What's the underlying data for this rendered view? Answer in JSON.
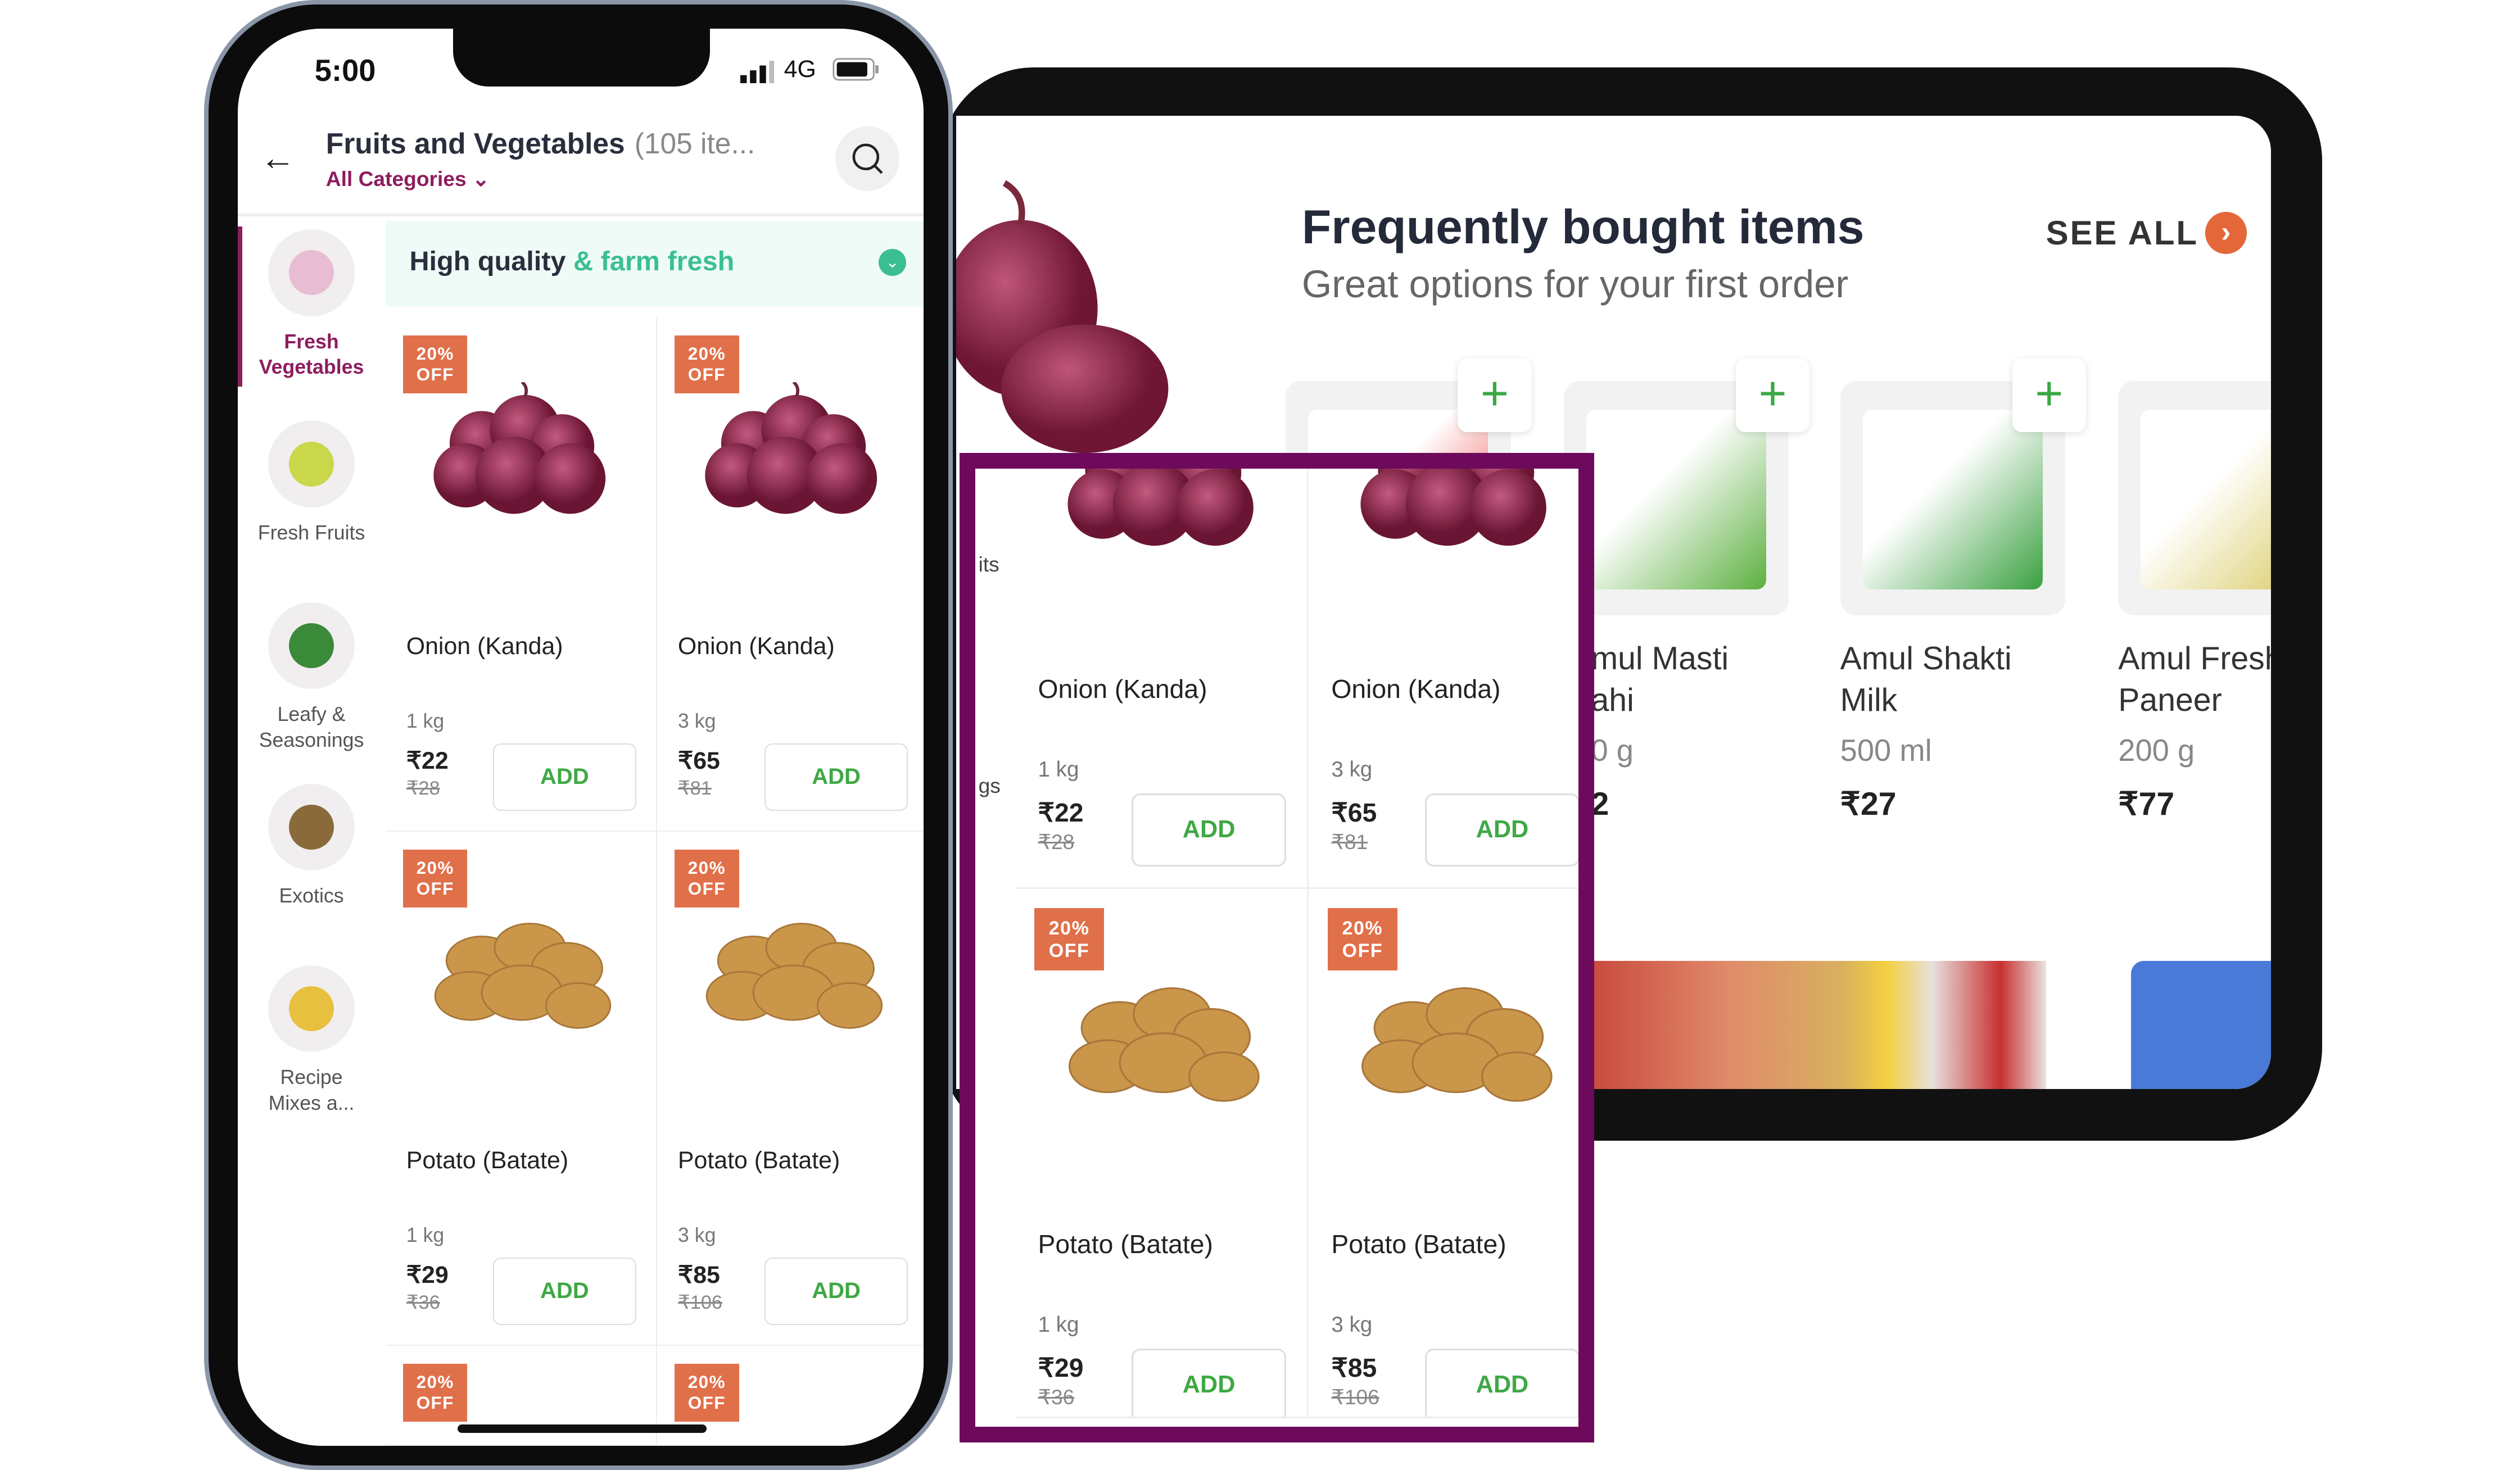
{
  "phone": {
    "status": {
      "time": "5:00",
      "network": "4G"
    },
    "header": {
      "title": "Fruits and Vegetables",
      "count": "(105 ite...",
      "category_dropdown": "All Categories"
    },
    "sidebar": [
      {
        "label_lines": [
          "Fresh",
          "Vegetables"
        ],
        "active": true,
        "image": "onion"
      },
      {
        "label_lines": [
          "Fresh Fruits"
        ],
        "active": false,
        "image": "pear"
      },
      {
        "label_lines": [
          "Leafy &",
          "Seasonings"
        ],
        "active": false,
        "image": "spinach"
      },
      {
        "label_lines": [
          "Exotics"
        ],
        "active": false,
        "image": "kiwi"
      },
      {
        "label_lines": [
          "Recipe",
          "Mixes a..."
        ],
        "active": false,
        "image": "pineapple"
      }
    ],
    "banner": {
      "text_dark": "High quality",
      "text_green": "& farm fresh"
    },
    "products": [
      {
        "discount": "20% OFF",
        "name": "Onion (Kanda)",
        "weight": "1 kg",
        "price": "₹22",
        "old_price": "₹28",
        "add": "ADD",
        "image": "onion"
      },
      {
        "discount": "20% OFF",
        "name": "Onion (Kanda)",
        "weight": "3 kg",
        "price": "₹65",
        "old_price": "₹81",
        "add": "ADD",
        "image": "onion"
      },
      {
        "discount": "20% OFF",
        "name": "Potato (Batate)",
        "weight": "1 kg",
        "price": "₹29",
        "old_price": "₹36",
        "add": "ADD",
        "image": "potato"
      },
      {
        "discount": "20% OFF",
        "name": "Potato (Batate)",
        "weight": "3 kg",
        "price": "₹85",
        "old_price": "₹106",
        "add": "ADD",
        "image": "potato"
      },
      {
        "discount": "20% OFF"
      },
      {
        "discount": "20% OFF"
      }
    ]
  },
  "tablet": {
    "title": "Frequently bought items",
    "subtitle": "Great options for your first order",
    "see_all": "SEE ALL",
    "items": [
      {
        "name_lines": [
          "",
          ""
        ],
        "size": "",
        "price": "",
        "image": "milk-pouch-red"
      },
      {
        "name_lines": [
          "mul Masti",
          "ahi"
        ],
        "size": "0 g",
        "price": "2",
        "image": "masti-dahi"
      },
      {
        "name_lines": [
          "Amul Shakti",
          "Milk"
        ],
        "size": "500 ml",
        "price": "₹27",
        "image": "shakti-milk"
      },
      {
        "name_lines": [
          "Amul Fresh",
          "Paneer"
        ],
        "size": "200 g",
        "price": "₹77",
        "image": "paneer"
      }
    ]
  },
  "overlay": {
    "sidebar_fragments": [
      "its",
      "gs"
    ]
  },
  "colors": {
    "brand_purple": "#8e1c5e",
    "overlay_border": "#6d0a5c",
    "discount": "#e0704a",
    "add_green": "#3fa845",
    "fresh_green": "#3bbf91",
    "see_all_orange": "#e4673a"
  }
}
